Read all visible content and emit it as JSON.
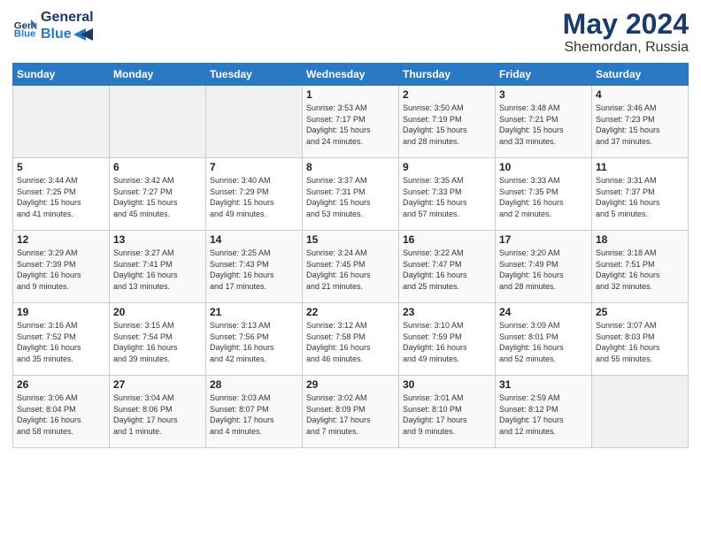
{
  "logo": {
    "line1": "General",
    "line2": "Blue"
  },
  "title": "May 2024",
  "location": "Shemordan, Russia",
  "days_header": [
    "Sunday",
    "Monday",
    "Tuesday",
    "Wednesday",
    "Thursday",
    "Friday",
    "Saturday"
  ],
  "weeks": [
    [
      {
        "day": "",
        "info": ""
      },
      {
        "day": "",
        "info": ""
      },
      {
        "day": "",
        "info": ""
      },
      {
        "day": "1",
        "info": "Sunrise: 3:53 AM\nSunset: 7:17 PM\nDaylight: 15 hours\nand 24 minutes."
      },
      {
        "day": "2",
        "info": "Sunrise: 3:50 AM\nSunset: 7:19 PM\nDaylight: 15 hours\nand 28 minutes."
      },
      {
        "day": "3",
        "info": "Sunrise: 3:48 AM\nSunset: 7:21 PM\nDaylight: 15 hours\nand 33 minutes."
      },
      {
        "day": "4",
        "info": "Sunrise: 3:46 AM\nSunset: 7:23 PM\nDaylight: 15 hours\nand 37 minutes."
      }
    ],
    [
      {
        "day": "5",
        "info": "Sunrise: 3:44 AM\nSunset: 7:25 PM\nDaylight: 15 hours\nand 41 minutes."
      },
      {
        "day": "6",
        "info": "Sunrise: 3:42 AM\nSunset: 7:27 PM\nDaylight: 15 hours\nand 45 minutes."
      },
      {
        "day": "7",
        "info": "Sunrise: 3:40 AM\nSunset: 7:29 PM\nDaylight: 15 hours\nand 49 minutes."
      },
      {
        "day": "8",
        "info": "Sunrise: 3:37 AM\nSunset: 7:31 PM\nDaylight: 15 hours\nand 53 minutes."
      },
      {
        "day": "9",
        "info": "Sunrise: 3:35 AM\nSunset: 7:33 PM\nDaylight: 15 hours\nand 57 minutes."
      },
      {
        "day": "10",
        "info": "Sunrise: 3:33 AM\nSunset: 7:35 PM\nDaylight: 16 hours\nand 2 minutes."
      },
      {
        "day": "11",
        "info": "Sunrise: 3:31 AM\nSunset: 7:37 PM\nDaylight: 16 hours\nand 5 minutes."
      }
    ],
    [
      {
        "day": "12",
        "info": "Sunrise: 3:29 AM\nSunset: 7:39 PM\nDaylight: 16 hours\nand 9 minutes."
      },
      {
        "day": "13",
        "info": "Sunrise: 3:27 AM\nSunset: 7:41 PM\nDaylight: 16 hours\nand 13 minutes."
      },
      {
        "day": "14",
        "info": "Sunrise: 3:25 AM\nSunset: 7:43 PM\nDaylight: 16 hours\nand 17 minutes."
      },
      {
        "day": "15",
        "info": "Sunrise: 3:24 AM\nSunset: 7:45 PM\nDaylight: 16 hours\nand 21 minutes."
      },
      {
        "day": "16",
        "info": "Sunrise: 3:22 AM\nSunset: 7:47 PM\nDaylight: 16 hours\nand 25 minutes."
      },
      {
        "day": "17",
        "info": "Sunrise: 3:20 AM\nSunset: 7:49 PM\nDaylight: 16 hours\nand 28 minutes."
      },
      {
        "day": "18",
        "info": "Sunrise: 3:18 AM\nSunset: 7:51 PM\nDaylight: 16 hours\nand 32 minutes."
      }
    ],
    [
      {
        "day": "19",
        "info": "Sunrise: 3:16 AM\nSunset: 7:52 PM\nDaylight: 16 hours\nand 35 minutes."
      },
      {
        "day": "20",
        "info": "Sunrise: 3:15 AM\nSunset: 7:54 PM\nDaylight: 16 hours\nand 39 minutes."
      },
      {
        "day": "21",
        "info": "Sunrise: 3:13 AM\nSunset: 7:56 PM\nDaylight: 16 hours\nand 42 minutes."
      },
      {
        "day": "22",
        "info": "Sunrise: 3:12 AM\nSunset: 7:58 PM\nDaylight: 16 hours\nand 46 minutes."
      },
      {
        "day": "23",
        "info": "Sunrise: 3:10 AM\nSunset: 7:59 PM\nDaylight: 16 hours\nand 49 minutes."
      },
      {
        "day": "24",
        "info": "Sunrise: 3:09 AM\nSunset: 8:01 PM\nDaylight: 16 hours\nand 52 minutes."
      },
      {
        "day": "25",
        "info": "Sunrise: 3:07 AM\nSunset: 8:03 PM\nDaylight: 16 hours\nand 55 minutes."
      }
    ],
    [
      {
        "day": "26",
        "info": "Sunrise: 3:06 AM\nSunset: 8:04 PM\nDaylight: 16 hours\nand 58 minutes."
      },
      {
        "day": "27",
        "info": "Sunrise: 3:04 AM\nSunset: 8:06 PM\nDaylight: 17 hours\nand 1 minute."
      },
      {
        "day": "28",
        "info": "Sunrise: 3:03 AM\nSunset: 8:07 PM\nDaylight: 17 hours\nand 4 minutes."
      },
      {
        "day": "29",
        "info": "Sunrise: 3:02 AM\nSunset: 8:09 PM\nDaylight: 17 hours\nand 7 minutes."
      },
      {
        "day": "30",
        "info": "Sunrise: 3:01 AM\nSunset: 8:10 PM\nDaylight: 17 hours\nand 9 minutes."
      },
      {
        "day": "31",
        "info": "Sunrise: 2:59 AM\nSunset: 8:12 PM\nDaylight: 17 hours\nand 12 minutes."
      },
      {
        "day": "",
        "info": ""
      }
    ]
  ]
}
